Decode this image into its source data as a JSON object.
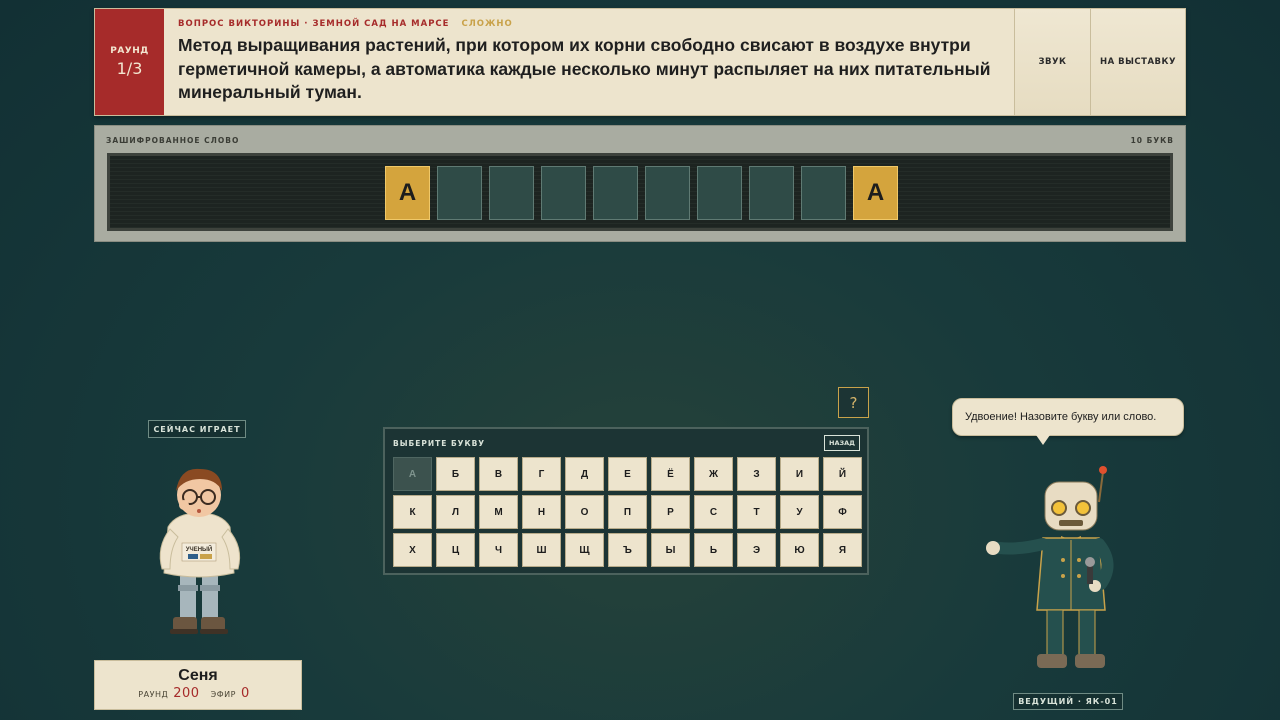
{
  "round": {
    "label": "РАУНД",
    "value": "1/3"
  },
  "question": {
    "category": "ВОПРОС ВИКТОРИНЫ · ЗЕМНОЙ САД НА МАРСЕ",
    "difficulty": "СЛОЖНО",
    "text": "Метод выращивания растений, при котором их корни свободно свисают в воздухе внутри герметичной камеры, а автоматика каждые несколько минут распыляет на них питательный минеральный туман."
  },
  "top_buttons": {
    "sound": "ЗВУК",
    "exhibit": "НА ВЫСТАВКУ"
  },
  "word": {
    "label": "ЗАШИФРОВАННОЕ СЛОВО",
    "count": "10 БУКВ",
    "tiles": [
      "А",
      "",
      "",
      "",
      "",
      "",
      "",
      "",
      "",
      "А"
    ],
    "revealed": [
      true,
      false,
      false,
      false,
      false,
      false,
      false,
      false,
      false,
      true
    ]
  },
  "player": {
    "now_playing": "СЕЙЧАС ИГРАЕТ",
    "name": "Сеня",
    "round_label": "РАУНД",
    "round_score": "200",
    "air_label": "ЭФИР",
    "air_score": "0",
    "sweater_text": "УЧЕНЫЙ"
  },
  "keyboard": {
    "title": "ВЫБЕРИТЕ БУКВУ",
    "back": "НАЗАД",
    "help": "?",
    "rows": [
      [
        "А",
        "Б",
        "В",
        "Г",
        "Д",
        "Е",
        "Ё",
        "Ж",
        "З",
        "И",
        "Й"
      ],
      [
        "К",
        "Л",
        "М",
        "Н",
        "О",
        "П",
        "Р",
        "С",
        "Т",
        "У",
        "Ф"
      ],
      [
        "Х",
        "Ц",
        "Ч",
        "Ш",
        "Щ",
        "Ъ",
        "Ы",
        "Ь",
        "Э",
        "Ю",
        "Я"
      ]
    ],
    "used": [
      "А"
    ]
  },
  "host": {
    "speech": "Удвоение! Назовите букву или слово.",
    "label": "ВЕДУЩИЙ · ЯК-01"
  },
  "colors": {
    "accent_red": "#a62b2a",
    "gold": "#d4a43d",
    "paper": "#ede4cd",
    "background": "#183a3b"
  }
}
